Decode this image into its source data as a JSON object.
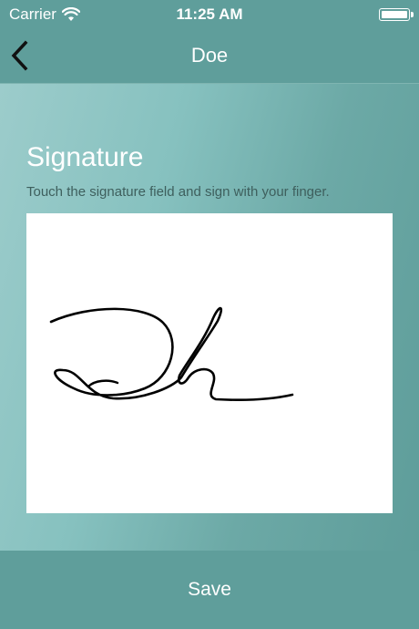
{
  "status_bar": {
    "carrier": "Carrier",
    "time": "11:25 AM",
    "wifi_icon": "wifi-icon",
    "battery_icon": "battery-icon"
  },
  "nav": {
    "back_icon": "chevron-left-icon",
    "title": "Doe"
  },
  "signature": {
    "heading": "Signature",
    "instructions": "Touch the signature field and sign with your finger."
  },
  "footer": {
    "save_label": "Save"
  },
  "colors": {
    "bar_background": "#5f9e9b",
    "gradient_light": "#9ccccb",
    "gradient_dark": "#5e9d9a",
    "text_white": "#ffffff",
    "subtext": "#3e5f5d"
  }
}
